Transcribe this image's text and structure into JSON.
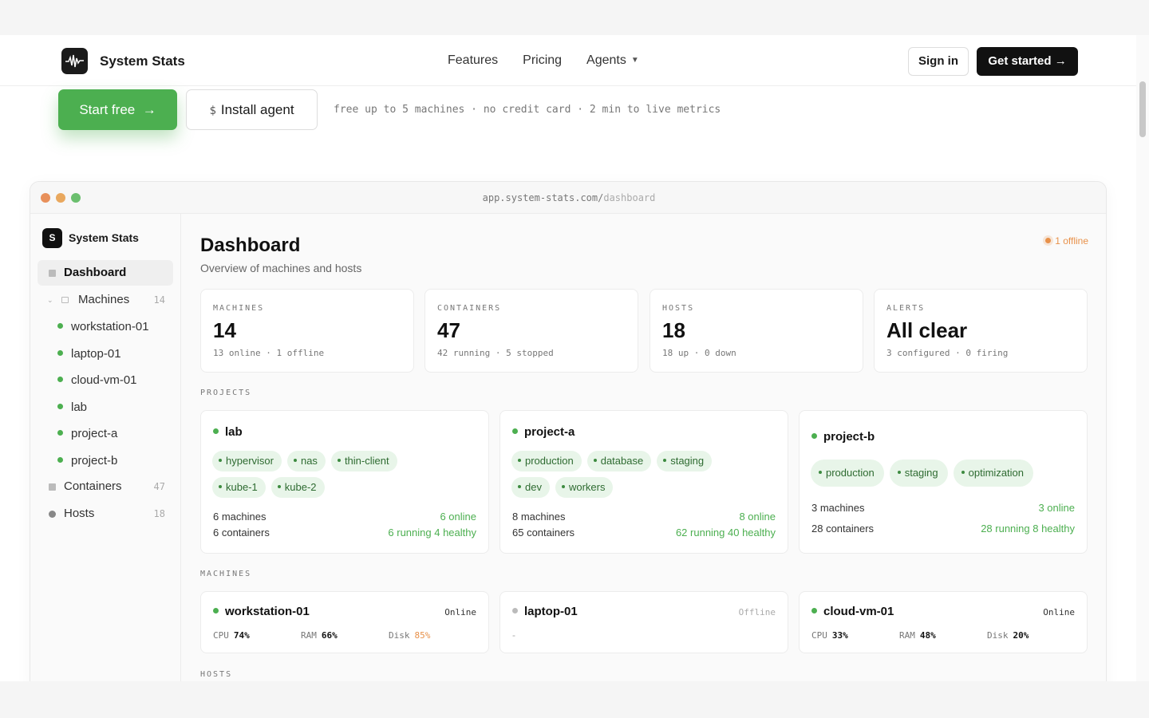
{
  "nav": {
    "brand": "System Stats",
    "links": [
      "Features",
      "Pricing",
      "Agents"
    ],
    "signin": "Sign in",
    "get_started": "Get started"
  },
  "hero": {
    "start_free": "Start free",
    "install_agent": "Install agent",
    "install_prefix": "$",
    "tagline": "free up to 5 machines · no credit card · 2 min to live metrics"
  },
  "browser": {
    "url_host": "app.system-stats.com/",
    "url_path": "dashboard"
  },
  "sidebar": {
    "logo_letter": "S",
    "brand": "System Stats",
    "dashboard": "Dashboard",
    "machines": "Machines",
    "machines_count": "14",
    "sub_items": [
      "workstation-01",
      "laptop-01",
      "cloud-vm-01",
      "lab",
      "project-a",
      "project-b"
    ],
    "containers": "Containers",
    "containers_count": "47",
    "hosts": "Hosts",
    "hosts_count": "18"
  },
  "main": {
    "title": "Dashboard",
    "subtitle": "Overview of machines and hosts",
    "offline_badge": "1 offline",
    "stats": [
      {
        "key": "MACHINES",
        "value": "14",
        "detail": "13 online · 1 offline"
      },
      {
        "key": "CONTAINERS",
        "value": "47",
        "detail": "42 running · 5 stopped"
      },
      {
        "key": "HOSTS",
        "value": "18",
        "detail": "18 up · 0 down"
      },
      {
        "key": "ALERTS",
        "value": "All clear",
        "detail": "3 configured · 0 firing"
      }
    ],
    "projects_label": "PROJECTS",
    "projects": [
      {
        "name": "lab",
        "tags": [
          "hypervisor",
          "nas",
          "thin-client",
          "kube-1",
          "kube-2"
        ],
        "machines": "6 machines",
        "online": "6 online",
        "containers": "6 containers",
        "running": "6 running 4 healthy"
      },
      {
        "name": "project-a",
        "tags": [
          "production",
          "database",
          "staging",
          "dev",
          "workers"
        ],
        "machines": "8 machines",
        "online": "8 online",
        "containers": "65 containers",
        "running": "62 running 40 healthy"
      },
      {
        "name": "project-b",
        "tags": [
          "production",
          "staging",
          "optimization"
        ],
        "machines": "3 machines",
        "online": "3 online",
        "containers": "28 containers",
        "running": "28 running 8 healthy"
      }
    ],
    "machines_label": "MACHINES",
    "machines": [
      {
        "name": "workstation-01",
        "status": "Online",
        "cpu_label": "CPU",
        "cpu": "74%",
        "ram_label": "RAM",
        "ram": "66%",
        "disk_label": "Disk",
        "disk": "85%"
      },
      {
        "name": "laptop-01",
        "status": "Offline",
        "dash": "-"
      },
      {
        "name": "cloud-vm-01",
        "status": "Online",
        "cpu_label": "CPU",
        "cpu": "33%",
        "ram_label": "RAM",
        "ram": "48%",
        "disk_label": "Disk",
        "disk": "20%"
      }
    ],
    "hosts_label": "HOSTS"
  }
}
